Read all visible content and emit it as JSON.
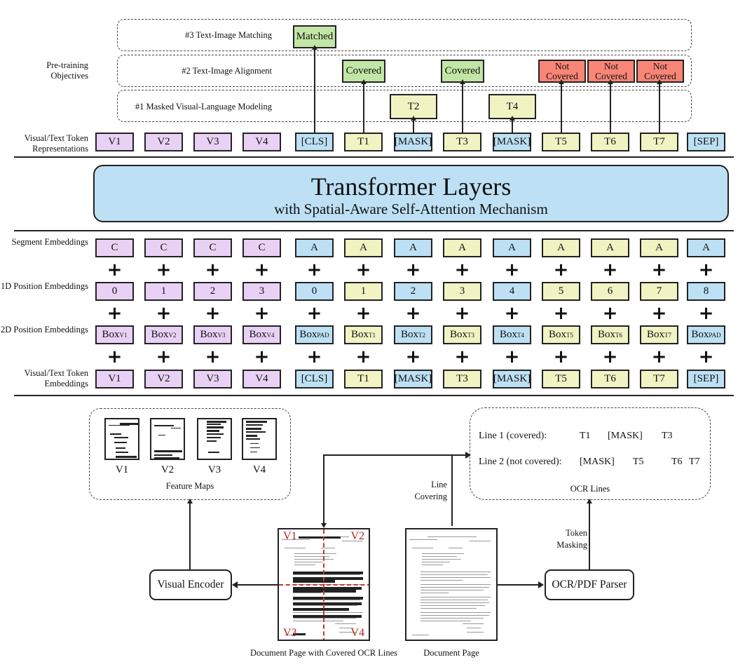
{
  "objectives": {
    "group_label": "Pre-training Objectives",
    "items": [
      {
        "label": "#3 Text-Image Matching",
        "outputs": [
          {
            "text": "Matched",
            "kind": "matched",
            "column": 4
          }
        ]
      },
      {
        "label": "#2 Text-Image Alignment",
        "outputs": [
          {
            "text": "Covered",
            "kind": "covered",
            "column": 5
          },
          {
            "text": "Covered",
            "kind": "covered",
            "column": 7
          },
          {
            "text": "Not Covered",
            "kind": "not-covered",
            "column": 9
          },
          {
            "text": "Not Covered",
            "kind": "not-covered",
            "column": 10
          },
          {
            "text": "Not Covered",
            "kind": "not-covered",
            "column": 11
          }
        ]
      },
      {
        "label": "#1 Masked Visual-Language Modeling",
        "outputs": [
          {
            "text": "T2",
            "kind": "text",
            "column": 6
          },
          {
            "text": "T4",
            "kind": "text",
            "column": 8
          }
        ]
      }
    ]
  },
  "representations": {
    "label": "Visual/Text Token Representations",
    "tokens": [
      "V1",
      "V2",
      "V3",
      "V4",
      "[CLS]",
      "T1",
      "[MASK]",
      "T3",
      "[MASK]",
      "T5",
      "T6",
      "T7",
      "[SEP]"
    ]
  },
  "transformer": {
    "title": "Transformer Layers",
    "subtitle": "with Spatial-Aware Self-Attention Mechanism"
  },
  "embeddings": {
    "token_kinds": [
      "visual",
      "visual",
      "visual",
      "visual",
      "special",
      "text",
      "special",
      "text",
      "special",
      "text",
      "text",
      "text",
      "special"
    ],
    "rows": [
      {
        "label": "Segment Embeddings",
        "values": [
          "C",
          "C",
          "C",
          "C",
          "A",
          "A",
          "A",
          "A",
          "A",
          "A",
          "A",
          "A",
          "A"
        ]
      },
      {
        "label": "1D Position Embeddings",
        "values": [
          "0",
          "1",
          "2",
          "3",
          "0",
          "1",
          "2",
          "3",
          "4",
          "5",
          "6",
          "7",
          "8"
        ]
      },
      {
        "label": "2D Position Embeddings",
        "base": "Box",
        "subscripts": [
          "V1",
          "V2",
          "V3",
          "V4",
          "PAD",
          "T1",
          "T2",
          "T3",
          "T4",
          "T5",
          "T6",
          "T7",
          "PAD"
        ]
      },
      {
        "label": "Visual/Text Token Embeddings",
        "values": [
          "V1",
          "V2",
          "V3",
          "V4",
          "[CLS]",
          "T1",
          "[MASK]",
          "T3",
          "[MASK]",
          "T5",
          "T6",
          "T7",
          "[SEP]"
        ]
      }
    ],
    "operator": "+"
  },
  "feature_maps": {
    "caption": "Feature Maps",
    "items": [
      "V1",
      "V2",
      "V3",
      "V4"
    ]
  },
  "ocr_lines": {
    "caption": "OCR Lines",
    "lines": [
      {
        "label": "Line 1 (covered):",
        "tokens": [
          "T1",
          "[MASK]",
          "T3"
        ]
      },
      {
        "label": "Line 2 (not covered):",
        "tokens": [
          "[MASK]",
          "T5",
          "T6",
          "T7"
        ]
      }
    ]
  },
  "pipeline": {
    "visual_encoder": "Visual Encoder",
    "parser": "OCR/PDF Parser",
    "line_covering": "Line Covering",
    "token_masking": "Token Masking",
    "covered_doc_caption": "Document Page with Covered OCR Lines",
    "doc_caption": "Document Page",
    "quadrants": [
      "V1",
      "V2",
      "V3",
      "V4"
    ]
  },
  "colors": {
    "visual": "#e9d1f5",
    "special": "#bde0f4",
    "text": "#f1f3c3",
    "matched": "#c2e6a6",
    "not_covered": "#f98577",
    "transformer": "#bde0f4",
    "quadrant_line": "#c0392b"
  }
}
